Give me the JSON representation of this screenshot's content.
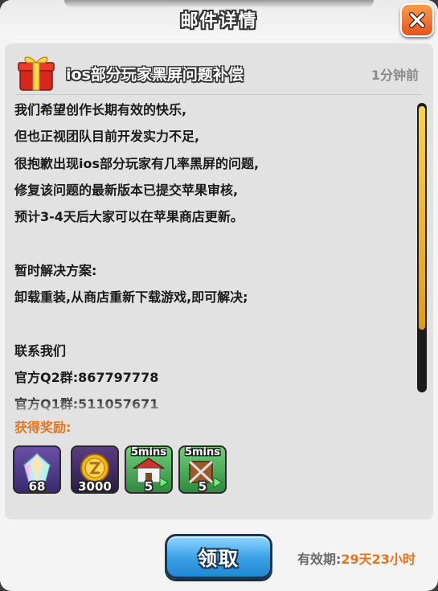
{
  "header": {
    "title": "邮件详情"
  },
  "mail": {
    "title": "ios部分玩家黑屏问题补偿",
    "time": "1分钟前",
    "body": [
      "我们希望创作长期有效的快乐,",
      "但也正视团队目前开发实力不足,",
      "很抱歉出现ios部分玩家有几率黑屏的问题,",
      "修复该问题的最新版本已提交苹果审核,",
      "预计3-4天后大家可以在苹果商店更新。",
      "",
      "暂时解决方案:",
      "卸载重装,从商店重新下载游戏,即可解决;",
      "",
      "联系我们",
      "官方Q2群:867797778",
      "官方Q1群:511057671"
    ],
    "scroll_position": 0.0
  },
  "rewards": {
    "label": "获得奖励:",
    "items": [
      {
        "icon": "gem-icon",
        "count": "68",
        "duration": ""
      },
      {
        "icon": "gold-coin-icon",
        "count": "3000",
        "duration": ""
      },
      {
        "icon": "house-speedup-icon",
        "count": "5",
        "duration": "5mins"
      },
      {
        "icon": "crate-speedup-icon",
        "count": "5",
        "duration": "5mins"
      }
    ]
  },
  "footer": {
    "claim_label": "领取",
    "expiry_label": "有效期:",
    "expiry_value": "29天23小时"
  },
  "colors": {
    "accent_orange": "#e8741c",
    "scroll_thumb": "#f2b52a",
    "claim_button": "#39a0e6",
    "close_button": "#f0762e"
  }
}
